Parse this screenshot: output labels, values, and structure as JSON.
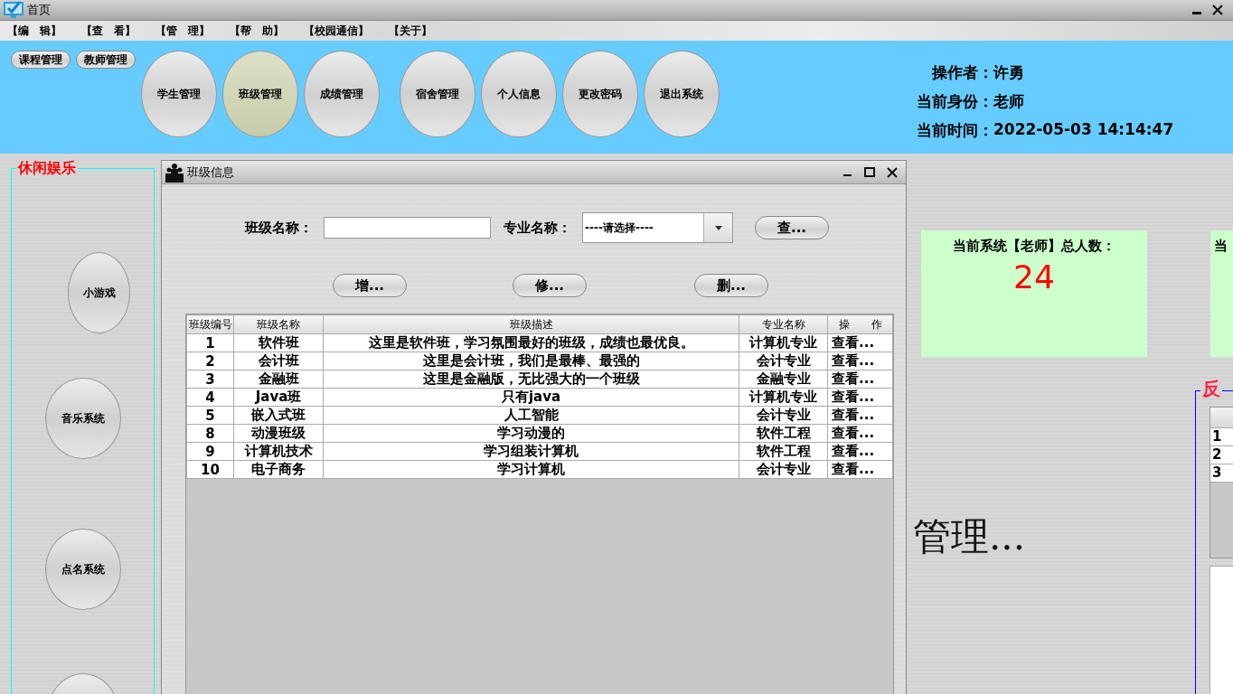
{
  "window": {
    "title": "首页"
  },
  "menu": [
    "【编　辑】",
    "【查　看】",
    "【管　理】",
    "【帮　助】",
    "【校园通信】",
    "【关于】"
  ],
  "toolbar": {
    "small_buttons": [
      "课程管理",
      "教师管理"
    ],
    "oval_buttons": [
      {
        "label": "学生管理",
        "selected": false
      },
      {
        "label": "班级管理",
        "selected": true
      },
      {
        "label": "成绩管理",
        "selected": false
      },
      {
        "label": "宿舍管理",
        "selected": false
      },
      {
        "label": "个人信息",
        "selected": false
      },
      {
        "label": "更改密码",
        "selected": false
      },
      {
        "label": "退出系统",
        "selected": false
      }
    ]
  },
  "user_info": [
    {
      "label": "操作者：",
      "value": "许勇"
    },
    {
      "label": "当前身份：",
      "value": "老师"
    },
    {
      "label": "当前时间：",
      "value": "2022-05-03 14:14:47"
    }
  ],
  "leisure": {
    "title": "休闲娱乐",
    "buttons": [
      {
        "kind": "full",
        "label": "小游戏"
      },
      {
        "kind": "full",
        "label": "音乐系统"
      },
      {
        "kind": "full",
        "label": "点名系统"
      },
      {
        "kind": "partial"
      }
    ]
  },
  "stats": [
    {
      "label": "当前系统【老师】总人数：",
      "value": "24"
    },
    {
      "label": "当"
    }
  ],
  "background_text": "管理...",
  "feedback": {
    "title": "反",
    "rows": [
      "1",
      "2",
      "3"
    ]
  },
  "class_window": {
    "title": "班级信息",
    "search": {
      "name_label": "班级名称：",
      "major_label": "专业名称：",
      "major_value": "----请选择----",
      "search_button": "查..."
    },
    "actions": [
      "增...",
      "修...",
      "删..."
    ],
    "table": {
      "columns": [
        "班级编号",
        "班级名称",
        "班级描述",
        "专业名称",
        "操　　作"
      ],
      "rows": [
        [
          "1",
          "软件班",
          "这里是软件班，学习氛围最好的班级，成绩也最优良。",
          "计算机专业",
          "查看..."
        ],
        [
          "2",
          "会计班",
          "这里是会计班，我们是最棒、最强的",
          "会计专业",
          "查看..."
        ],
        [
          "3",
          "金融班",
          "这里是金融版，无比强大的一个班级",
          "金融专业",
          "查看..."
        ],
        [
          "4",
          "Java班",
          "只有java",
          "计算机专业",
          "查看..."
        ],
        [
          "5",
          "嵌入式班",
          "人工智能",
          "会计专业",
          "查看..."
        ],
        [
          "8",
          "动漫班级",
          "学习动漫的",
          "软件工程",
          "查看..."
        ],
        [
          "9",
          "计算机技术",
          "学习组装计算机",
          "软件工程",
          "查看..."
        ],
        [
          "10",
          "电子商务",
          "学习计算机",
          "会计专业",
          "查看..."
        ]
      ]
    }
  }
}
